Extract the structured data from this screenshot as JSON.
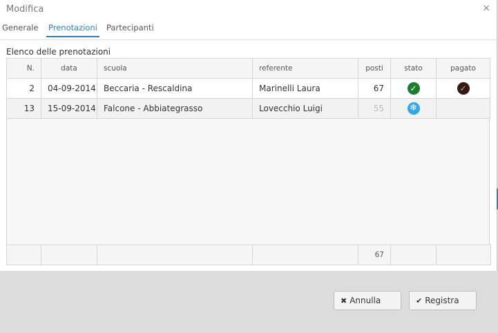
{
  "dialog": {
    "title": "Modifica",
    "close_glyph": "×"
  },
  "tabs": [
    {
      "label": "Generale",
      "active": false
    },
    {
      "label": "Prenotazioni",
      "active": true
    },
    {
      "label": "Partecipanti",
      "active": false
    }
  ],
  "list_title": "Elenco delle prenotazioni",
  "table": {
    "headers": [
      "N.",
      "data",
      "scuola",
      "referente",
      "posti",
      "stato",
      "pagato"
    ],
    "rows": [
      {
        "n": "2",
        "data": "04-09-2014",
        "scuola": "Beccaria - Rescaldina",
        "referente": "Marinelli Laura",
        "posti": "67",
        "stato_icon": "check-icon",
        "pagato_icon": "paid-check-icon"
      },
      {
        "n": "13",
        "data": "15-09-2014",
        "scuola": "Falcone - Abbiategrasso",
        "referente": "Lovecchio Luigi",
        "posti": "55",
        "stato_icon": "snowflake-icon",
        "pagato_icon": ""
      }
    ],
    "footer": {
      "posti_total": "67"
    }
  },
  "buttons": {
    "cancel": {
      "label": "Annulla",
      "icon": "times-icon"
    },
    "save": {
      "label": "Registra",
      "icon": "check-icon"
    }
  },
  "colors": {
    "accent": "#2a7fb8",
    "ok": "#1c7d2b",
    "frozen": "#2ea9f0"
  }
}
